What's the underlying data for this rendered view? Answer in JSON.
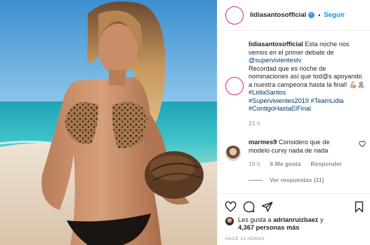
{
  "post": {
    "username": "lidiasantosofficial",
    "dot": "•",
    "follow_label": "Seguir",
    "verified_mark": "✓"
  },
  "caption": {
    "username": "lidiasantosofficial",
    "text_1": " Esta noche nos vemos en el primer debate de ",
    "mention": "@supervivientestv",
    "text_2": "Recordad que es noche de nominaciones así que tod@s apoyando a nuestra campeona hasta la final!",
    "emoji": "💪🏼🏝",
    "hashtag_1": "#LidiaSantos",
    "hashtag_2": "#Supervivientes2019",
    "hashtag_3": "#TeamLidia",
    "hashtag_4": "#ContigoHastaElFinal",
    "time": "21 h"
  },
  "comment": {
    "username": "marmes9",
    "text": " Considero que de modelo curvy nada de nada",
    "time": "19 h",
    "likes": "6 Me gusta",
    "reply_label": "Responder",
    "view_replies": "Ver respuestas (11)"
  },
  "footer": {
    "likes_prefix": "Les gusta a ",
    "liker": "adrianruizbaez",
    "likes_mid": " y",
    "likes_count": "4,367 personas más",
    "time_ago": "HACE 21 HORAS"
  },
  "icons": {
    "like": "heart-icon",
    "comment": "comment-icon",
    "share": "share-icon",
    "save": "bookmark-icon"
  },
  "colors": {
    "link": "#0095f6",
    "tag": "#00376b",
    "muted": "#8e8e8e",
    "text": "#262626"
  }
}
